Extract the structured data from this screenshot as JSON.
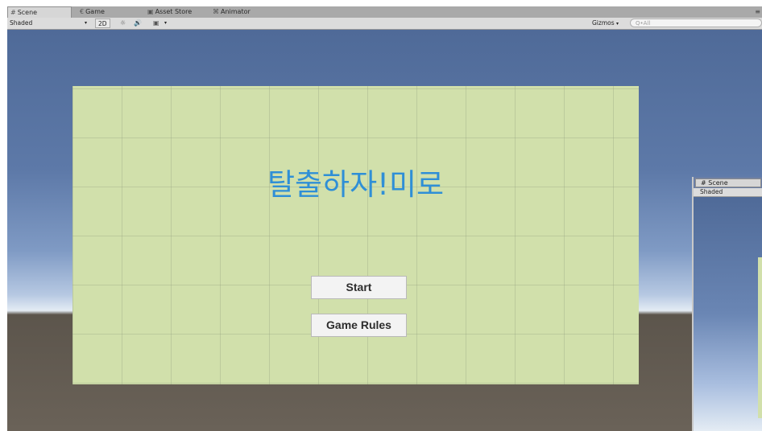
{
  "tabs": [
    {
      "icon": "#",
      "label": "Scene"
    },
    {
      "icon": "€",
      "label": "Game"
    },
    {
      "icon": "▣",
      "label": "Asset Store"
    },
    {
      "icon": "⌘",
      "label": "Animator"
    }
  ],
  "toolbar": {
    "shading_mode": "Shaded",
    "mode_2d": "2D",
    "gizmos": "Gizmos",
    "search_placeholder": "Q•All"
  },
  "scene": {
    "title": "탈출하자!미로",
    "start_button": "Start",
    "rules_button": "Game Rules",
    "panel_color": "#d1e0ab",
    "title_color": "#2f8fd6"
  },
  "mini_view": {
    "tab_label": "Scene",
    "shading_mode": "Shaded"
  }
}
